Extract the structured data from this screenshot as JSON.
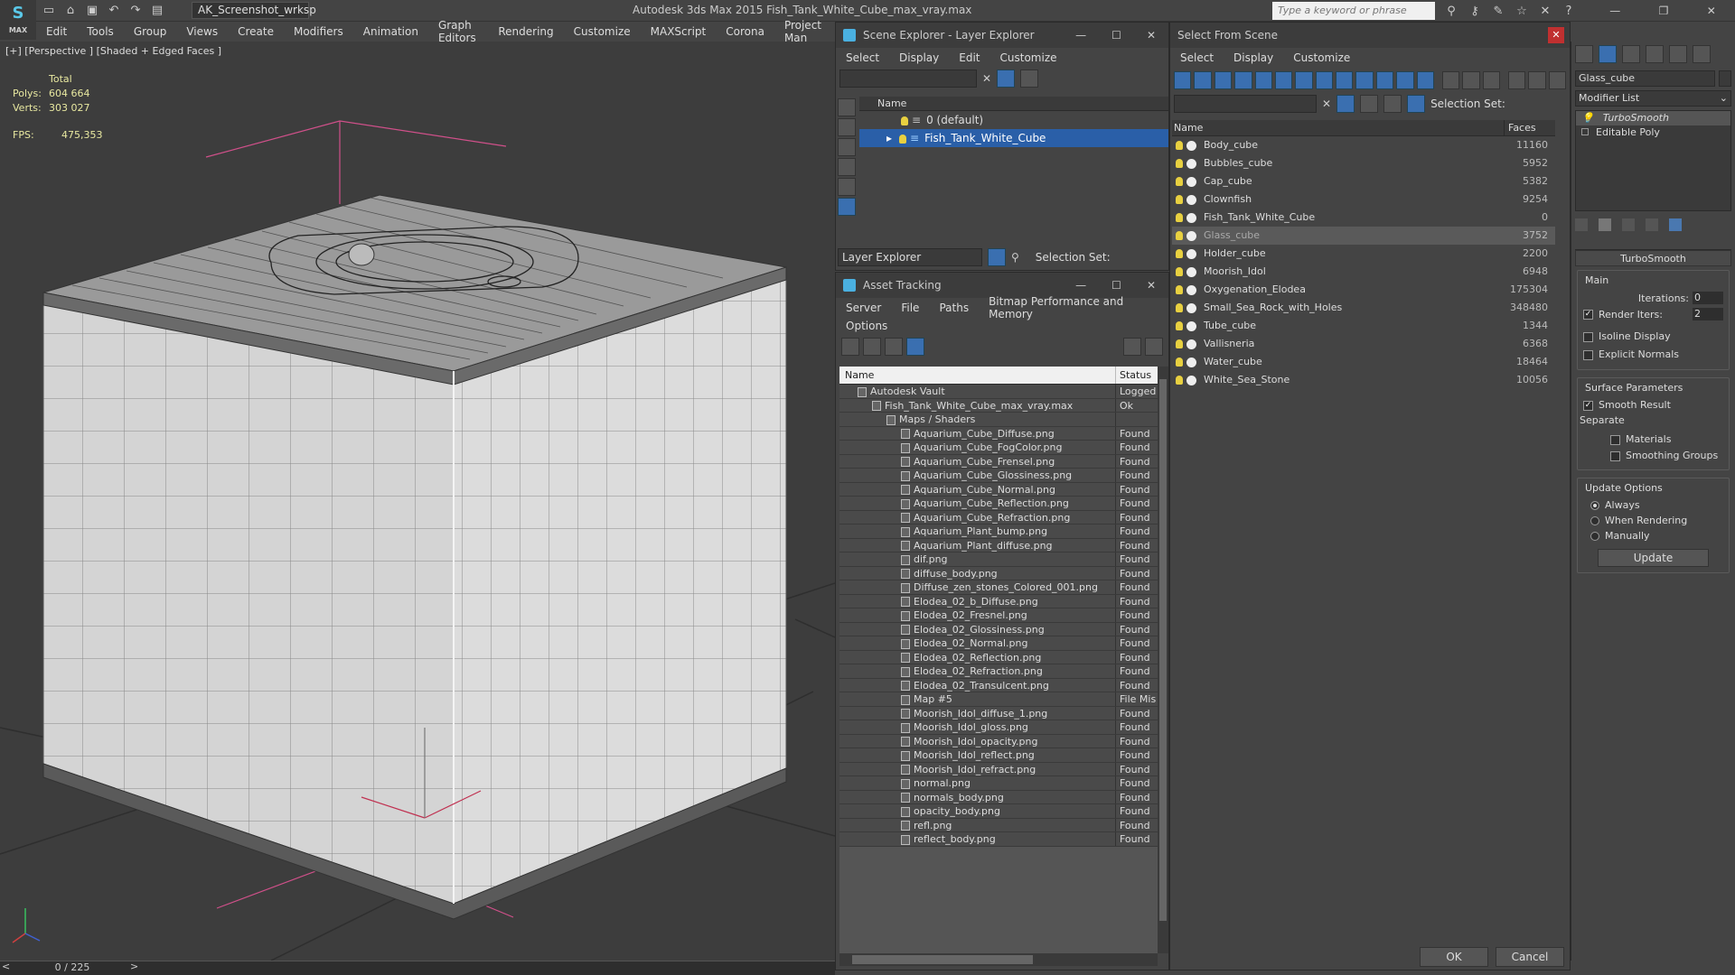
{
  "app": {
    "logo": "MAX",
    "workspace": "AK_Screenshot_wrksp",
    "title": "Autodesk 3ds Max  2015     Fish_Tank_White_Cube_max_vray.max",
    "search_placeholder": "Type a keyword or phrase"
  },
  "menubar": [
    "Edit",
    "Tools",
    "Group",
    "Views",
    "Create",
    "Modifiers",
    "Animation",
    "Graph Editors",
    "Rendering",
    "Customize",
    "MAXScript",
    "Corona",
    "Project Man"
  ],
  "viewport": {
    "label": "[+] [Perspective ] [Shaded + Edged Faces ]",
    "stats_total": "Total",
    "polys_label": "Polys:",
    "polys_value": "604 664",
    "verts_label": "Verts:",
    "verts_value": "303 027",
    "fps_label": "FPS:",
    "fps_value": "475,353",
    "time": "0 / 225"
  },
  "scene_explorer": {
    "title": "Scene Explorer - Layer Explorer",
    "menu": [
      "Select",
      "Display",
      "Edit",
      "Customize"
    ],
    "col_name": "Name",
    "layers": [
      "0 (default)",
      "Fish_Tank_White_Cube"
    ],
    "footer_mode": "Layer Explorer",
    "footer_selset": "Selection Set:"
  },
  "asset_tracking": {
    "title": "Asset Tracking",
    "menu": [
      "Server",
      "File",
      "Paths",
      "Bitmap Performance and Memory"
    ],
    "menu2": "Options",
    "col_name": "Name",
    "col_status": "Status",
    "rows": [
      {
        "name": "Autodesk Vault",
        "status": "Logged",
        "indent": 0
      },
      {
        "name": "Fish_Tank_White_Cube_max_vray.max",
        "status": "Ok",
        "indent": 1
      },
      {
        "name": "Maps / Shaders",
        "status": "",
        "indent": 2
      },
      {
        "name": "Aquarium_Cube_Diffuse.png",
        "status": "Found",
        "indent": 3
      },
      {
        "name": "Aquarium_Cube_FogColor.png",
        "status": "Found",
        "indent": 3
      },
      {
        "name": "Aquarium_Cube_Frensel.png",
        "status": "Found",
        "indent": 3
      },
      {
        "name": "Aquarium_Cube_Glossiness.png",
        "status": "Found",
        "indent": 3
      },
      {
        "name": "Aquarium_Cube_Normal.png",
        "status": "Found",
        "indent": 3
      },
      {
        "name": "Aquarium_Cube_Reflection.png",
        "status": "Found",
        "indent": 3
      },
      {
        "name": "Aquarium_Cube_Refraction.png",
        "status": "Found",
        "indent": 3
      },
      {
        "name": "Aquarium_Plant_bump.png",
        "status": "Found",
        "indent": 3
      },
      {
        "name": "Aquarium_Plant_diffuse.png",
        "status": "Found",
        "indent": 3
      },
      {
        "name": "dif.png",
        "status": "Found",
        "indent": 3
      },
      {
        "name": "diffuse_body.png",
        "status": "Found",
        "indent": 3
      },
      {
        "name": "Diffuse_zen_stones_Colored_001.png",
        "status": "Found",
        "indent": 3
      },
      {
        "name": "Elodea_02_b_Diffuse.png",
        "status": "Found",
        "indent": 3
      },
      {
        "name": "Elodea_02_Fresnel.png",
        "status": "Found",
        "indent": 3
      },
      {
        "name": "Elodea_02_Glossiness.png",
        "status": "Found",
        "indent": 3
      },
      {
        "name": "Elodea_02_Normal.png",
        "status": "Found",
        "indent": 3
      },
      {
        "name": "Elodea_02_Reflection.png",
        "status": "Found",
        "indent": 3
      },
      {
        "name": "Elodea_02_Refraction.png",
        "status": "Found",
        "indent": 3
      },
      {
        "name": "Elodea_02_Transulcent.png",
        "status": "Found",
        "indent": 3
      },
      {
        "name": "Map #5",
        "status": "File Mis",
        "indent": 3
      },
      {
        "name": "Moorish_Idol_diffuse_1.png",
        "status": "Found",
        "indent": 3
      },
      {
        "name": "Moorish_Idol_gloss.png",
        "status": "Found",
        "indent": 3
      },
      {
        "name": "Moorish_Idol_opacity.png",
        "status": "Found",
        "indent": 3
      },
      {
        "name": "Moorish_Idol_reflect.png",
        "status": "Found",
        "indent": 3
      },
      {
        "name": "Moorish_Idol_refract.png",
        "status": "Found",
        "indent": 3
      },
      {
        "name": "normal.png",
        "status": "Found",
        "indent": 3
      },
      {
        "name": "normals_body.png",
        "status": "Found",
        "indent": 3
      },
      {
        "name": "opacity_body.png",
        "status": "Found",
        "indent": 3
      },
      {
        "name": "refl.png",
        "status": "Found",
        "indent": 3
      },
      {
        "name": "reflect_body.png",
        "status": "Found",
        "indent": 3
      }
    ]
  },
  "select_from_scene": {
    "title": "Select From Scene",
    "menu": [
      "Select",
      "Display",
      "Customize"
    ],
    "selset": "Selection Set:",
    "col_name": "Name",
    "col_faces": "Faces",
    "objects": [
      {
        "name": "Body_cube",
        "faces": "11160"
      },
      {
        "name": "Bubbles_cube",
        "faces": "5952"
      },
      {
        "name": "Cap_cube",
        "faces": "5382"
      },
      {
        "name": "Clownfish",
        "faces": "9254"
      },
      {
        "name": "Fish_Tank_White_Cube",
        "faces": "0"
      },
      {
        "name": "Glass_cube",
        "faces": "3752"
      },
      {
        "name": "Holder_cube",
        "faces": "2200"
      },
      {
        "name": "Moorish_Idol",
        "faces": "6948"
      },
      {
        "name": "Oxygenation_Elodea",
        "faces": "175304"
      },
      {
        "name": "Small_Sea_Rock_with_Holes",
        "faces": "348480"
      },
      {
        "name": "Tube_cube",
        "faces": "1344"
      },
      {
        "name": "Vallisneria",
        "faces": "6368"
      },
      {
        "name": "Water_cube",
        "faces": "18464"
      },
      {
        "name": "White_Sea_Stone",
        "faces": "10056"
      }
    ],
    "ok": "OK",
    "cancel": "Cancel"
  },
  "command_panel": {
    "object_name": "Glass_cube",
    "modifier_list": "Modifier List",
    "stack": [
      "TurboSmooth",
      "Editable Poly"
    ],
    "rollout": "TurboSmooth",
    "main": "Main",
    "iterations_label": "Iterations:",
    "iterations": "0",
    "render_iters_label": "Render Iters:",
    "render_iters": "2",
    "isoline": "Isoline Display",
    "explicit": "Explicit Normals",
    "surface": "Surface Parameters",
    "smooth_result": "Smooth Result",
    "separate": "Separate",
    "materials": "Materials",
    "smoothing_groups": "Smoothing Groups",
    "update_options": "Update Options",
    "always": "Always",
    "when_rendering": "When Rendering",
    "manually": "Manually",
    "update": "Update"
  },
  "colors": {
    "selection": "#2a5fa8",
    "accent": "#4ab0e0"
  }
}
